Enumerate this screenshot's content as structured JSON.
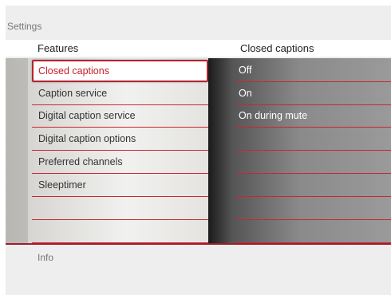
{
  "header": {
    "title": "Settings",
    "left_column_title": "Features",
    "right_column_title": "Closed captions"
  },
  "menu": {
    "items": [
      {
        "label": "Closed captions"
      },
      {
        "label": "Caption service"
      },
      {
        "label": "Digital caption service"
      },
      {
        "label": "Digital caption options"
      },
      {
        "label": "Preferred channels"
      },
      {
        "label": "Sleeptimer"
      }
    ],
    "selected_index": 0
  },
  "submenu": {
    "items": [
      {
        "label": "Off"
      },
      {
        "label": "On"
      },
      {
        "label": "On during mute"
      }
    ]
  },
  "footer": {
    "info_label": "Info"
  },
  "colors": {
    "accent": "#c41e2b",
    "rule": "#c9272f"
  }
}
